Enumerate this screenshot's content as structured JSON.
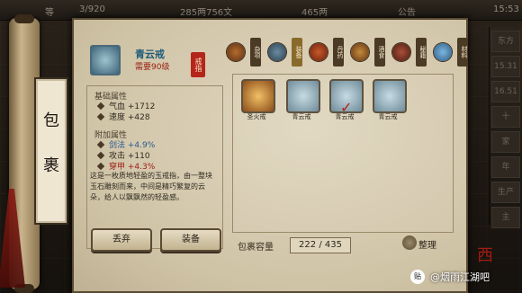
{
  "topbar": {
    "level_text": "等",
    "exp": "3/920",
    "money": "285两756文",
    "gold": "465两",
    "notice": "公告",
    "time": "15:53"
  },
  "bag": {
    "title1": "包",
    "title2": "裹"
  },
  "item": {
    "name": "青云戒",
    "level": "需要90级",
    "stamp": "戒指"
  },
  "stats": {
    "basic_title": "基础属性",
    "basic": [
      "气血 +1712",
      "速度 +428"
    ],
    "extra_title": "附加属性",
    "extra": [
      "剑法 +4.9%",
      "攻击 +110",
      "穿甲 +4.3%"
    ]
  },
  "description": "这是一枚质地轻盈的玉戒指，由一整块玉石雕刻而来，中间是精巧繁复的云朵，给人以飘飘然的轻盈感。",
  "buttons": {
    "discard": "丢弃",
    "equip": "装备",
    "sort": "整理"
  },
  "tabs": [
    {
      "label": "杂项",
      "icon": "misc-bag-icon"
    },
    {
      "label": "装备",
      "icon": "equipment-icon"
    },
    {
      "label": "丹药",
      "icon": "pill-icon"
    },
    {
      "label": "酒食",
      "icon": "food-icon"
    },
    {
      "label": "秘籍",
      "icon": "manual-icon"
    },
    {
      "label": "材料",
      "icon": "material-icon"
    }
  ],
  "items": [
    {
      "label": "圣火戒",
      "icon": "ring-fire-icon"
    },
    {
      "label": "青云戒",
      "icon": "ring-jade-icon"
    },
    {
      "label": "青云戒",
      "icon": "ring-jade-icon"
    },
    {
      "label": "青云戒",
      "icon": "ring-jade-icon"
    }
  ],
  "capacity": {
    "label": "包裹容量",
    "value": "222 / 435"
  },
  "right_strip": [
    "东方",
    "15.31",
    "16.51",
    "十",
    "家",
    "年",
    "生产",
    "主"
  ],
  "watermark": {
    "text": "@烟雨江湖吧"
  }
}
